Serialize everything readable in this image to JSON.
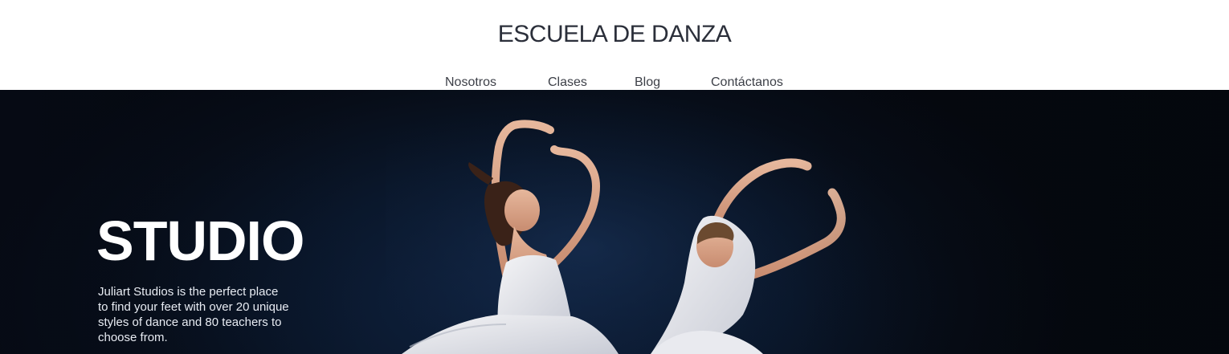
{
  "header": {
    "site_title": "ESCUELA DE DANZA",
    "nav": [
      {
        "label": "Nosotros"
      },
      {
        "label": "Clases"
      },
      {
        "label": "Blog"
      },
      {
        "label": "Contáctanos"
      }
    ]
  },
  "hero": {
    "heading": "STUDIO",
    "description": "Juliart Studios is the perfect place to find your feet with over 20 unique styles of dance and 80 teachers to choose from.",
    "image": "two-dancers-photo"
  },
  "colors": {
    "header_bg": "#ffffff",
    "title_text": "#2b2f3a",
    "nav_text": "#3c3f47",
    "hero_bg": "#0a172b",
    "hero_text": "#ffffff"
  }
}
